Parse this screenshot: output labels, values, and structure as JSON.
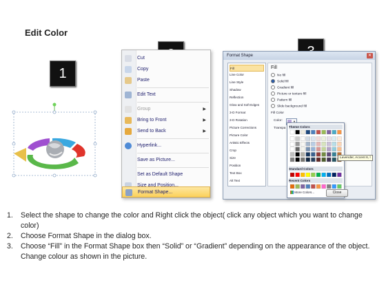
{
  "title": "Edit Color",
  "steps": [
    "1",
    "2",
    "3"
  ],
  "context_menu": {
    "items": [
      {
        "label": "Cut",
        "icon": "scissors-icon"
      },
      {
        "label": "Copy",
        "icon": "copy-icon"
      },
      {
        "label": "Paste",
        "icon": "paste-icon"
      },
      {
        "label": "Edit Text",
        "icon": "edit-text-icon"
      },
      {
        "label": "Group",
        "icon": "group-icon"
      },
      {
        "label": "Bring to Front",
        "icon": "bring-front-icon"
      },
      {
        "label": "Send to Back",
        "icon": "send-back-icon"
      },
      {
        "label": "Hyperlink...",
        "icon": "globe-icon"
      },
      {
        "label": "Save as Picture...",
        "icon": ""
      },
      {
        "label": "Set as Default Shape",
        "icon": ""
      },
      {
        "label": "Size and Position...",
        "icon": "size-icon"
      },
      {
        "label": "Format Shape...",
        "icon": "format-shape-icon"
      }
    ]
  },
  "dialog": {
    "title": "Format Shape",
    "categories": [
      "Fill",
      "Line Color",
      "Line Style",
      "Shadow",
      "Reflection",
      "Glow and Soft Edges",
      "3-D Format",
      "3-D Rotation",
      "Picture Corrections",
      "Picture Color",
      "Artistic Effects",
      "Crop",
      "Size",
      "Position",
      "Text Box",
      "Alt Text"
    ],
    "section": "Fill",
    "options": [
      "No fill",
      "Solid fill",
      "Gradient fill",
      "Picture or texture fill",
      "Pattern fill",
      "Slide background fill"
    ],
    "fill_color_label": "Fill Color",
    "color_label": "Color:",
    "transparency_label": "Transpa",
    "close_label": "Close",
    "palette": {
      "theme_label": "Theme Colors",
      "standard_label": "Standard Colors",
      "recent_label": "Recent Colors",
      "more_label": "More Colors...",
      "tooltip": "Lavender, Accent 6, l"
    }
  },
  "instructions": [
    {
      "num": "1.",
      "text": "Select the shape to change the color and Right click the object( click any object which you want to change color)"
    },
    {
      "num": "2.",
      "text": "Choose Format Shape in the dialog box."
    },
    {
      "num": "3.",
      "text": "Choose “Fill” in the Format Shape box then “Solid” or “Gradient” depending on the appearance of the object. Change colour as shown in the picture."
    }
  ]
}
